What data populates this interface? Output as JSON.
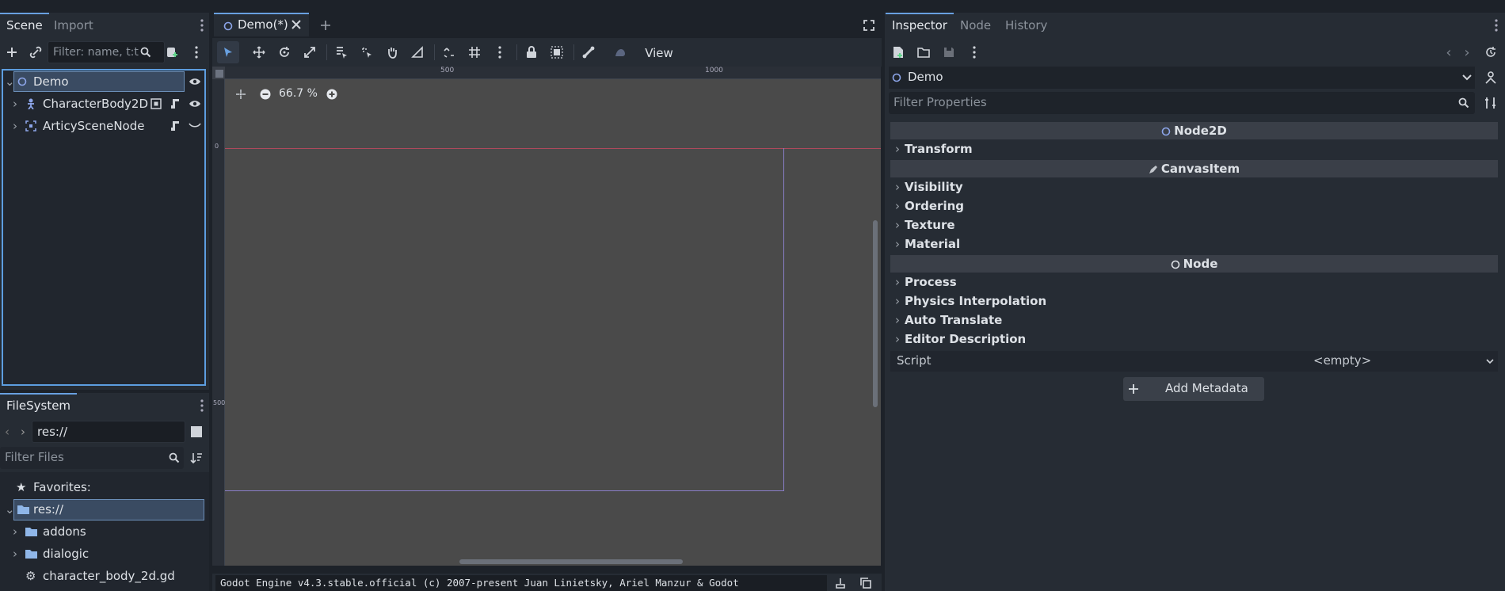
{
  "top": {
    "scene_tab": "Scene",
    "import_tab": "Import",
    "editor_tab": "Demo(*)",
    "inspector_tab": "Inspector",
    "node_tab": "Node",
    "history_tab": "History"
  },
  "scene": {
    "filter_placeholder": "Filter: name, t:t",
    "nodes": [
      {
        "label": "Demo"
      },
      {
        "label": "CharacterBody2D"
      },
      {
        "label": "ArticySceneNode"
      }
    ]
  },
  "filesystem": {
    "title": "FileSystem",
    "path": "res://",
    "filter_placeholder": "Filter Files",
    "favorites": "Favorites:",
    "items": [
      {
        "label": "res://"
      },
      {
        "label": "addons"
      },
      {
        "label": "dialogic"
      },
      {
        "label": "character_body_2d.gd"
      }
    ]
  },
  "viewport": {
    "view_menu": "View",
    "zoom": "66.7 %",
    "ruler": [
      "500",
      "1000"
    ],
    "vruler": [
      "0",
      "500"
    ]
  },
  "inspector": {
    "object_name": "Demo",
    "filter_placeholder": "Filter Properties",
    "sections": [
      {
        "title": "Node2D",
        "props": [
          "Transform"
        ]
      },
      {
        "title": "CanvasItem",
        "props": [
          "Visibility",
          "Ordering",
          "Texture",
          "Material"
        ]
      },
      {
        "title": "Node",
        "props": [
          "Process",
          "Physics Interpolation",
          "Auto Translate",
          "Editor Description"
        ]
      }
    ],
    "script_label": "Script",
    "script_value": "<empty>",
    "add_metadata": "Add Metadata"
  },
  "output": {
    "text": "Godot Engine v4.3.stable.official (c) 2007-present Juan Linietsky, Ariel Manzur & Godot"
  },
  "colors": {
    "accent": "#68a0e0",
    "background": "#1d2229",
    "panel": "#262c34",
    "viewport": "#4a4a4a",
    "x_axis": "#d04a50",
    "bounds": "#8a7ec8"
  }
}
